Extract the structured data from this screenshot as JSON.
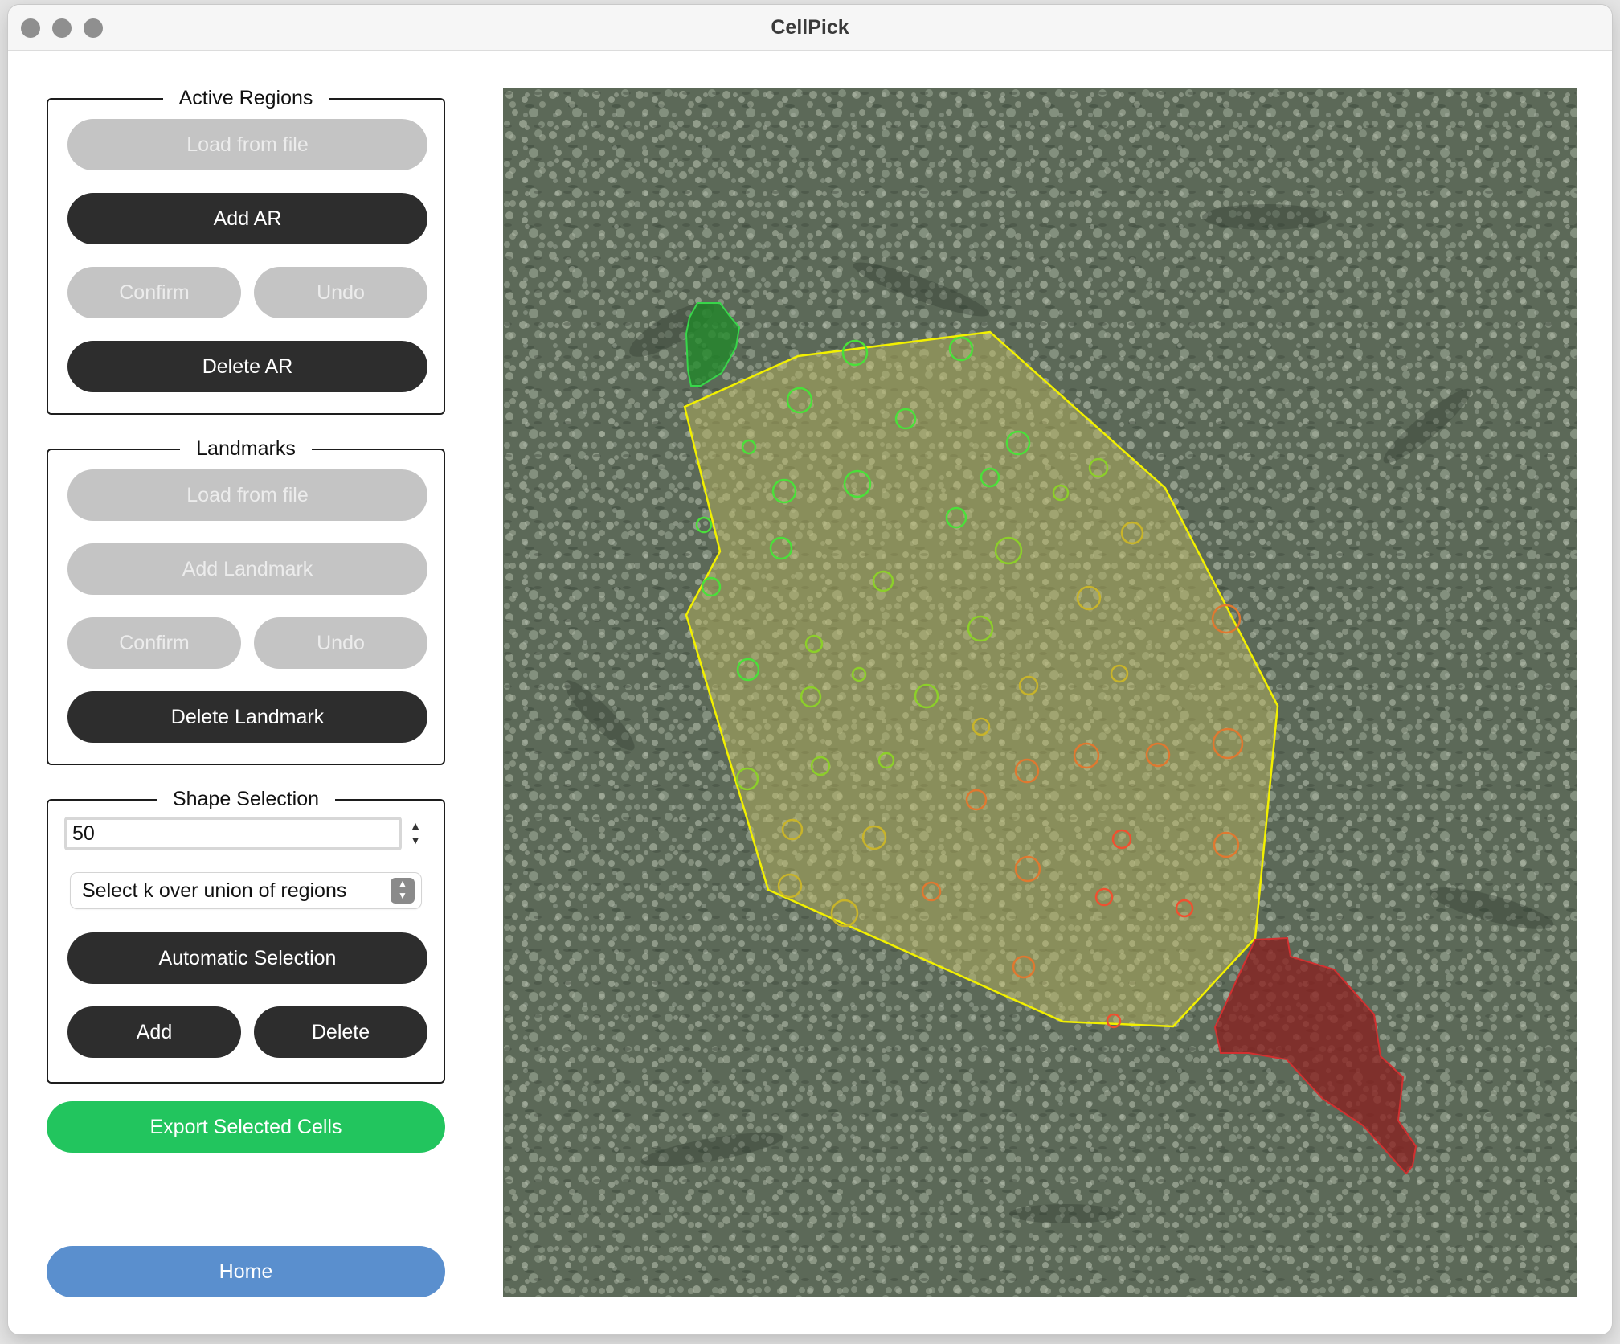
{
  "window": {
    "title": "CellPick"
  },
  "active_regions": {
    "title": "Active Regions",
    "load_label": "Load from file",
    "add_label": "Add AR",
    "confirm_label": "Confirm",
    "undo_label": "Undo",
    "delete_label": "Delete AR"
  },
  "landmarks": {
    "title": "Landmarks",
    "load_label": "Load from file",
    "add_label": "Add Landmark",
    "confirm_label": "Confirm",
    "undo_label": "Undo",
    "delete_label": "Delete Landmark"
  },
  "shape_selection": {
    "title": "Shape Selection",
    "k_value": "50",
    "mode_selected": "Select k over union of regions",
    "auto_label": "Automatic Selection",
    "add_label": "Add",
    "delete_label": "Delete"
  },
  "export_label": "Export Selected Cells",
  "home_label": "Home",
  "colors": {
    "dark_button": "#2d2d2d",
    "disabled_button": "#c4c4c4",
    "export_green": "#22c55e",
    "home_blue": "#5a8fce",
    "region_outline": "#ffff33",
    "landmark_green": "#1f8a2a",
    "landmark_red": "#8b1e1e"
  }
}
